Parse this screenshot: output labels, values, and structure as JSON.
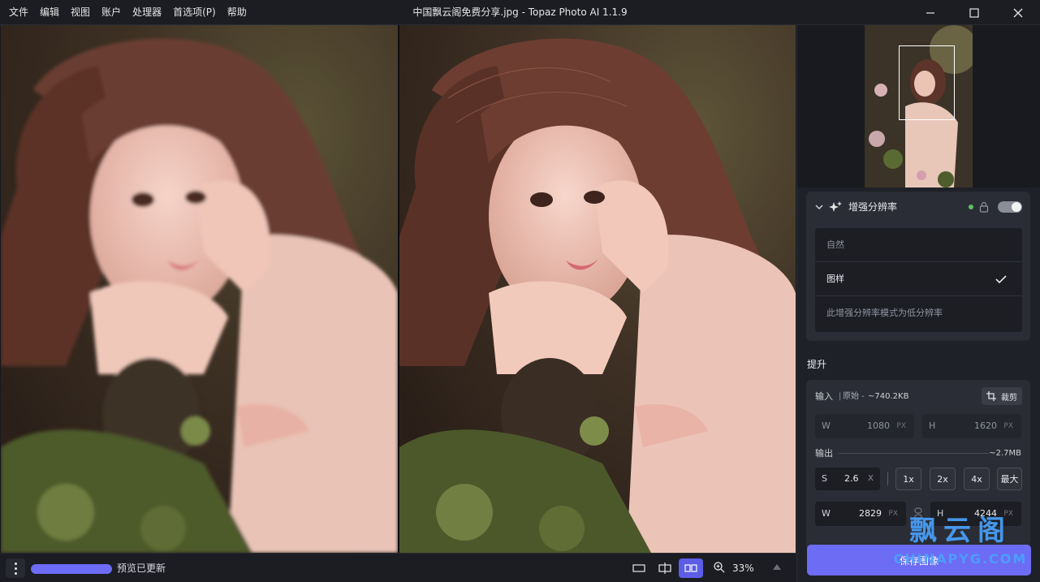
{
  "window": {
    "title": "中国飘云阁免费分享.jpg - Topaz Photo AI 1.1.9"
  },
  "menu": [
    "文件",
    "编辑",
    "视图",
    "账户",
    "处理器",
    "首选项(P)",
    "帮助"
  ],
  "bottombar": {
    "status": "预览已更新",
    "progress": 1.0,
    "zoom": "33%"
  },
  "enhance": {
    "title": "增强分辨率",
    "enabled": true,
    "models": [
      {
        "label": "自然",
        "selected": false
      },
      {
        "label": "图样",
        "selected": true
      }
    ],
    "note": "此增强分辨率模式为低分辨率"
  },
  "upscale": {
    "section_title": "提升",
    "input_label": "输入",
    "input_separator": "|",
    "input_original": "原始 -",
    "input_size": "~740.2KB",
    "crop_label": "裁剪",
    "input_w": {
      "label": "W",
      "value": "1080",
      "unit": "PX"
    },
    "input_h": {
      "label": "H",
      "value": "1620",
      "unit": "PX"
    },
    "output_label": "输出",
    "output_size": "~2.7MB",
    "scale": {
      "label": "S",
      "value": "2.6",
      "unit": "X"
    },
    "scale_options": [
      "1x",
      "2x",
      "4x",
      "最大"
    ],
    "output_w": {
      "label": "W",
      "value": "2829",
      "unit": "PX"
    },
    "output_h": {
      "label": "H",
      "value": "4244",
      "unit": "PX"
    }
  },
  "save_label": "保存图像",
  "watermark": {
    "cn": "飘云阁",
    "en": "CHINAPYG.COM"
  },
  "colors": {
    "accent": "#6c6cf4",
    "panel": "#2a2d35",
    "background": "#16181d"
  }
}
